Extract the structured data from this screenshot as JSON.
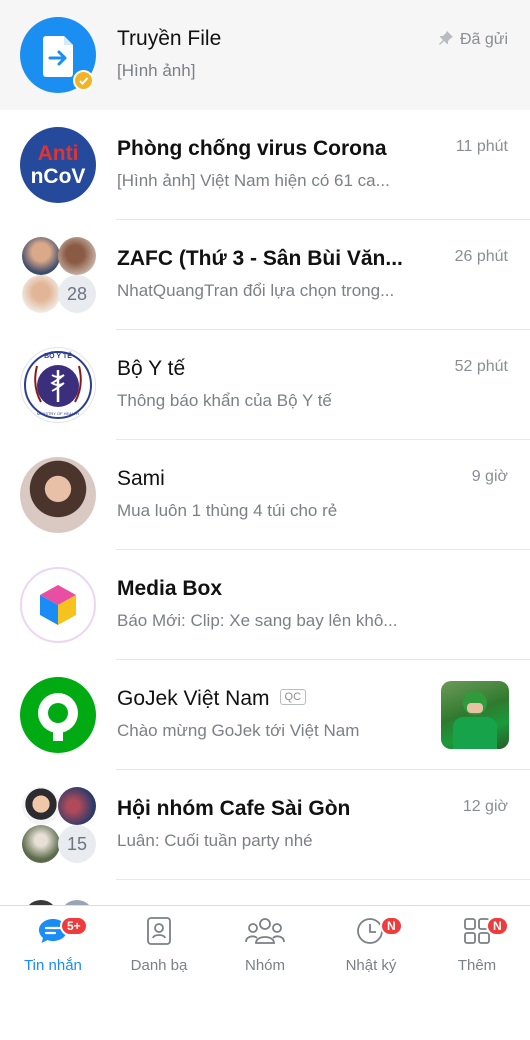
{
  "conversations": [
    {
      "title": "Truyền File",
      "subtitle": "[Hình ảnh]",
      "time": "Đã gửi",
      "pinned": true
    },
    {
      "title": "Phòng chống virus Corona",
      "subtitle": "[Hình ảnh] Việt Nam hiện có 61 ca...",
      "time": "11 phút",
      "avatar_top": "Anti",
      "avatar_bottom": "nCoV"
    },
    {
      "title": "ZAFC (Thứ 3 - Sân Bùi Văn...",
      "subtitle": "NhatQuangTran đổi lựa chọn trong...",
      "time": "26 phút",
      "member_count": "28"
    },
    {
      "title": "Bộ Y tế",
      "subtitle": "Thông báo khẩn của Bộ Y tế",
      "time": "52 phút",
      "avatar_top": "BỘ Y TẾ",
      "avatar_bottom": "MINISTRY OF HEALTH"
    },
    {
      "title": "Sami",
      "subtitle": "Mua luôn 1 thùng 4 túi cho rẻ",
      "time": "9 giờ"
    },
    {
      "title": "Media Box",
      "subtitle": "Báo Mới: Clip: Xe sang bay lên khô..."
    },
    {
      "title": "GoJek Việt Nam",
      "ad_tag": "QC",
      "subtitle": "Chào mừng GoJek tới Việt Nam"
    },
    {
      "title": "Hội nhóm Cafe Sài Gòn",
      "subtitle": "Luân: Cuối tuần party nhé",
      "time": "12 giờ",
      "member_count": "15"
    }
  ],
  "tabs": [
    {
      "label": "Tin nhắn",
      "badge": "5+",
      "active": true,
      "icon": "chat-icon"
    },
    {
      "label": "Danh bạ",
      "icon": "contacts-icon"
    },
    {
      "label": "Nhóm",
      "icon": "group-icon"
    },
    {
      "label": "Nhật ký",
      "badge": "N",
      "icon": "timeline-icon"
    },
    {
      "label": "Thêm",
      "badge": "N",
      "icon": "more-icon"
    }
  ],
  "colors": {
    "accent": "#1a8cf5",
    "badge": "#ef3b3b",
    "gojek": "#00aa13",
    "file_avatar": "#1b8ff1"
  }
}
